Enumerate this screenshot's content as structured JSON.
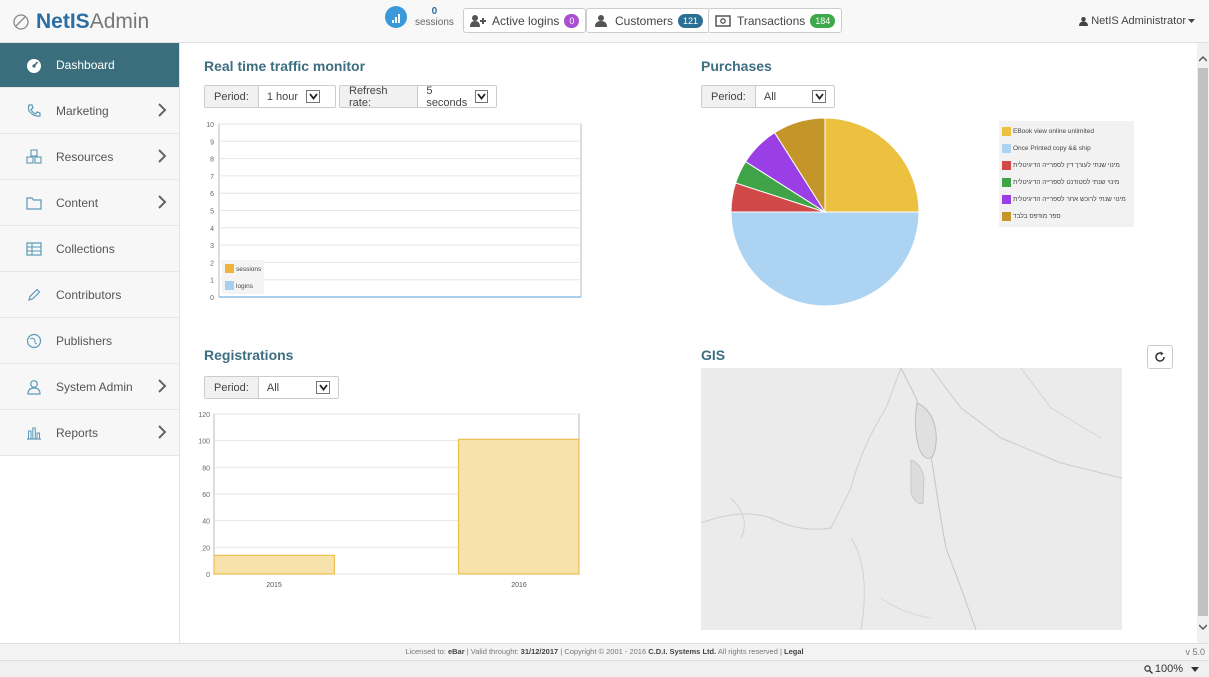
{
  "topbar": {
    "brand_bold": "NetIS",
    "brand_light": "Admin",
    "sessions_count": "0",
    "sessions_label": "sessions",
    "active_logins_label": "Active logins",
    "active_logins_count": "0",
    "customers_label": "Customers",
    "customers_count": "121",
    "transactions_label": "Transactions",
    "transactions_count": "184",
    "user_label": "NetIS Administrator"
  },
  "sidebar": {
    "items": [
      {
        "label": "Dashboard",
        "icon": "dashboard-icon",
        "active": true
      },
      {
        "label": "Marketing",
        "icon": "phone-icon",
        "chevron": true
      },
      {
        "label": "Resources",
        "icon": "cubes-icon",
        "chevron": true
      },
      {
        "label": "Content",
        "icon": "folder-icon",
        "chevron": true
      },
      {
        "label": "Collections",
        "icon": "table-icon"
      },
      {
        "label": "Contributors",
        "icon": "pencil-icon"
      },
      {
        "label": "Publishers",
        "icon": "globe-icon"
      },
      {
        "label": "System Admin",
        "icon": "user-icon",
        "chevron": true
      },
      {
        "label": "Reports",
        "icon": "bar-chart-icon",
        "chevron": true
      }
    ]
  },
  "traffic": {
    "title": "Real time traffic monitor",
    "period_label": "Period:",
    "period_value": "1 hour",
    "refresh_label": "Refresh rate:",
    "refresh_value": "5 seconds"
  },
  "purchases": {
    "title": "Purchases",
    "period_label": "Period:",
    "period_value": "All"
  },
  "registrations": {
    "title": "Registrations",
    "period_label": "Period:",
    "period_value": "All"
  },
  "gis": {
    "title": "GIS"
  },
  "footer": {
    "licensed_prefix": "Licensed to:",
    "licensee": "eBar",
    "valid_prefix": "Valid throught:",
    "valid_date": "31/12/2017",
    "copyright_prefix": "Copyright © 2001 - 2016",
    "company": "C.D.I. Systems Ltd.",
    "rights": "All rights reserved",
    "legal": "Legal",
    "version": "v 5.0"
  },
  "zoom": {
    "level": "100%"
  },
  "colors": {
    "accent": "#3b6e7c",
    "title": "#3e6f80",
    "badge_purple": "#a94fd0",
    "badge_blue": "#2a6f94",
    "badge_green": "#3ea84a"
  },
  "chart_data": [
    {
      "type": "line",
      "ylim": [
        0,
        10
      ],
      "yticks": [
        0,
        1,
        2,
        3,
        4,
        5,
        6,
        7,
        8,
        9,
        10
      ],
      "series": [
        {
          "name": "sessions",
          "color": "#f0b43c",
          "values": [
            0,
            0
          ]
        },
        {
          "name": "logins",
          "color": "#a8cfee",
          "values": [
            0,
            0
          ]
        }
      ]
    },
    {
      "type": "pie",
      "slices": [
        {
          "label": "EBook view online unlimited",
          "value": 25,
          "color": "#ecc140"
        },
        {
          "label": "Once Printed copy && ship",
          "value": 50,
          "color": "#acd4f2"
        },
        {
          "label": "מינוי שנתי לעורך דין לספרייה הדיגיטלית",
          "value": 5,
          "color": "#d04848"
        },
        {
          "label": "מינוי שנתי לסטודנט לספרייה הדיגיטלית",
          "value": 4,
          "color": "#3fa447"
        },
        {
          "label": "מינוי שנתי לרוכש אחר לספרייה הדיגיטלית",
          "value": 7,
          "color": "#9a3fe6"
        },
        {
          "label": "ספר מודפס בלבד",
          "value": 9,
          "color": "#c4962a"
        }
      ]
    },
    {
      "type": "bar",
      "categories": [
        "2015",
        "2016"
      ],
      "values": [
        14,
        101
      ],
      "ylim": [
        0,
        120
      ],
      "yticks": [
        0,
        20,
        40,
        60,
        80,
        100,
        120
      ],
      "color": "#f7e2ac",
      "border": "#ecbf52"
    }
  ]
}
